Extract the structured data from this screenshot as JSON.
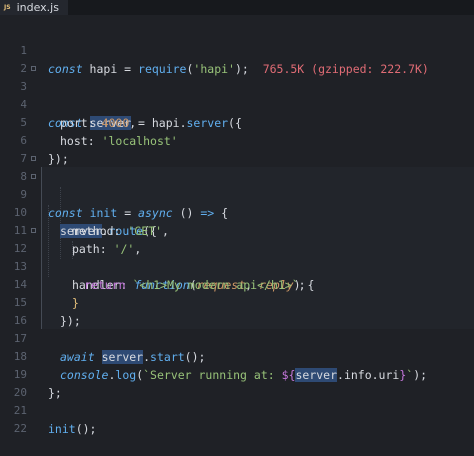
{
  "tab": {
    "icon": "JS",
    "filename": "index.js"
  },
  "lines": [
    {
      "n": "1"
    },
    {
      "n": "2"
    },
    {
      "n": "3"
    },
    {
      "n": "4"
    },
    {
      "n": "5"
    },
    {
      "n": "6"
    },
    {
      "n": "7"
    },
    {
      "n": "8"
    },
    {
      "n": "9"
    },
    {
      "n": "10"
    },
    {
      "n": "11"
    },
    {
      "n": "12"
    },
    {
      "n": "13"
    },
    {
      "n": "14"
    },
    {
      "n": "15"
    },
    {
      "n": "16"
    },
    {
      "n": "17"
    },
    {
      "n": "18"
    },
    {
      "n": "19"
    },
    {
      "n": "20"
    },
    {
      "n": "21"
    },
    {
      "n": "22"
    }
  ],
  "code": {
    "l1": {
      "a": "const",
      "b": " hapi = ",
      "c": "require",
      "d": "(",
      "e": "'hapi'",
      "f": ");",
      "g": "765.5K (gzipped: 222.7K)"
    },
    "l3": {
      "a": "const",
      "b": " ",
      "c": "server",
      "d": " = hapi.",
      "e": "server",
      "f": "({"
    },
    "l4": {
      "a": "port",
      "b": ": ",
      "c": "4000",
      "d": ","
    },
    "l5": {
      "a": "host",
      "b": ": ",
      "c": "'localhost'"
    },
    "l6": {
      "a": "});"
    },
    "l8": {
      "a": "const",
      "b": " ",
      "c": "init",
      "d": " = ",
      "e": "async",
      "f": " () ",
      "g": "=>",
      "h": " {"
    },
    "l9": {
      "a": "server",
      "b": ".",
      "c": "route",
      "d": "({"
    },
    "l10": {
      "a": "method",
      "b": ": ",
      "c": "'GET'",
      "d": ","
    },
    "l11": {
      "a": "path",
      "b": ": ",
      "c": "'/'",
      "d": ","
    },
    "l12": {
      "a": "handler",
      "b": ": ",
      "c": "function",
      "d": "(",
      "e": "request",
      "f": ", ",
      "g": "reply",
      "h": ") {"
    },
    "l13": {
      "a": "return",
      "b": " ",
      "c": "`<h1>My modern api</h1>`",
      "d": ";"
    },
    "l14": {
      "a": "}"
    },
    "l15": {
      "a": "});"
    },
    "l17": {
      "a": "await",
      "b": " ",
      "c": "server",
      "d": ".",
      "e": "start",
      "f": "();"
    },
    "l18": {
      "a": "console",
      "b": ".",
      "c": "log",
      "d": "(",
      "e": "`Server running at: ",
      "f": "${",
      "g": "server",
      "h": ".info.uri",
      "i": "}",
      "j": "`",
      "k": ");"
    },
    "l19": {
      "a": "};"
    },
    "l21": {
      "a": "init",
      "b": "();"
    }
  },
  "colors": {
    "background": "#1f2126",
    "keyword": "#61afef",
    "string": "#98c379",
    "number": "#d19a66",
    "size_info": "#e06c75"
  }
}
